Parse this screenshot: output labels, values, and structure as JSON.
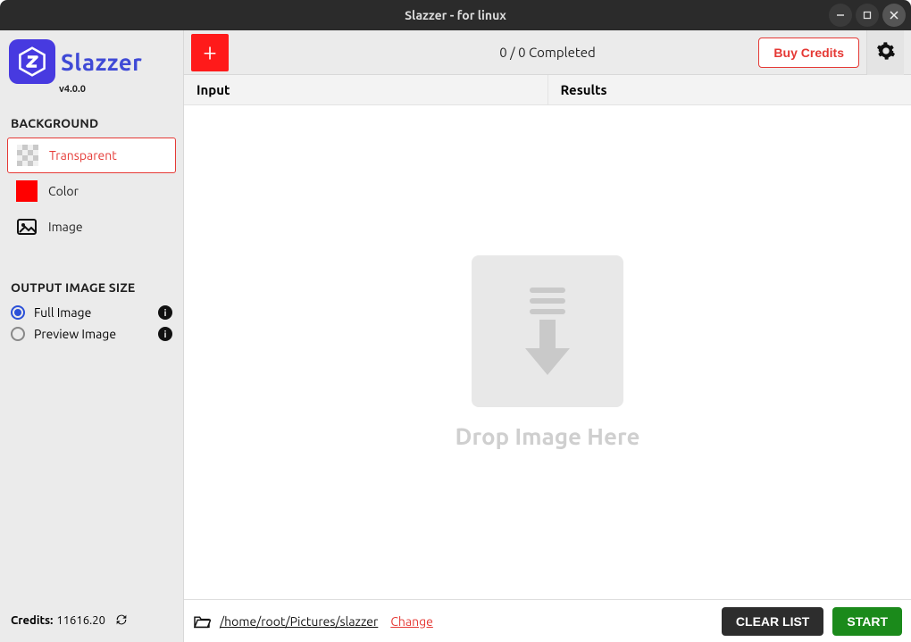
{
  "window": {
    "title": "Slazzer - for linux"
  },
  "logo": {
    "name": "Slazzer",
    "version": "v4.0.0"
  },
  "sidebar": {
    "bg_heading": "BACKGROUND",
    "bg_options": {
      "transparent": "Transparent",
      "color": "Color",
      "image": "Image"
    },
    "size_heading": "OUTPUT IMAGE SIZE",
    "size_options": {
      "full": "Full Image",
      "preview": "Preview Image"
    },
    "credits_label": "Credits:",
    "credits_value": "11616.20"
  },
  "top": {
    "completed": "0 / 0 Completed",
    "buy_credits": "Buy Credits"
  },
  "columns": {
    "input": "Input",
    "results": "Results"
  },
  "drop": {
    "text": "Drop Image Here"
  },
  "bottom": {
    "output_path": "/home/root/Pictures/slazzer",
    "change": "Change",
    "clear": "CLEAR LIST",
    "start": "START"
  }
}
